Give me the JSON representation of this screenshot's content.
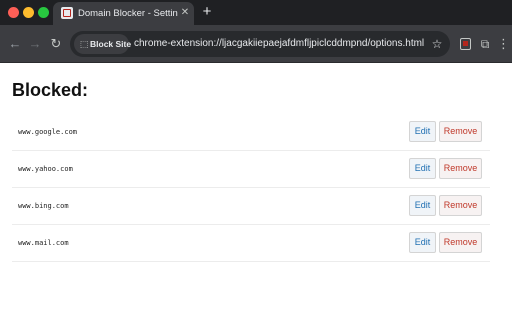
{
  "window": {
    "tab_title": "Domain Blocker - Settings",
    "tab_close_glyph": "✕",
    "new_tab_glyph": "+"
  },
  "toolbar": {
    "back_glyph": "←",
    "forward_glyph": "→",
    "reload_glyph": "↻",
    "chip_label": "Block Site",
    "chip_icon": "puzzle-icon",
    "url": "chrome-extension://ljacgakiiepaejafdmfljpiclcddmpnd/options.html",
    "star_glyph": "☆",
    "puzzle_glyph": "⧉",
    "menu_glyph": "⋮"
  },
  "page": {
    "title": "Blocked:",
    "edit_label": "Edit",
    "remove_label": "Remove",
    "blocked": [
      {
        "domain": "www.google.com"
      },
      {
        "domain": "www.yahoo.com"
      },
      {
        "domain": "www.bing.com"
      },
      {
        "domain": "www.mail.com"
      }
    ]
  },
  "colors": {
    "tabstrip": "#1f2023",
    "toolbar": "#3c3d41",
    "omnibox": "#282a2d",
    "edit_text": "#1f6fb2",
    "remove_text": "#c0392b"
  }
}
